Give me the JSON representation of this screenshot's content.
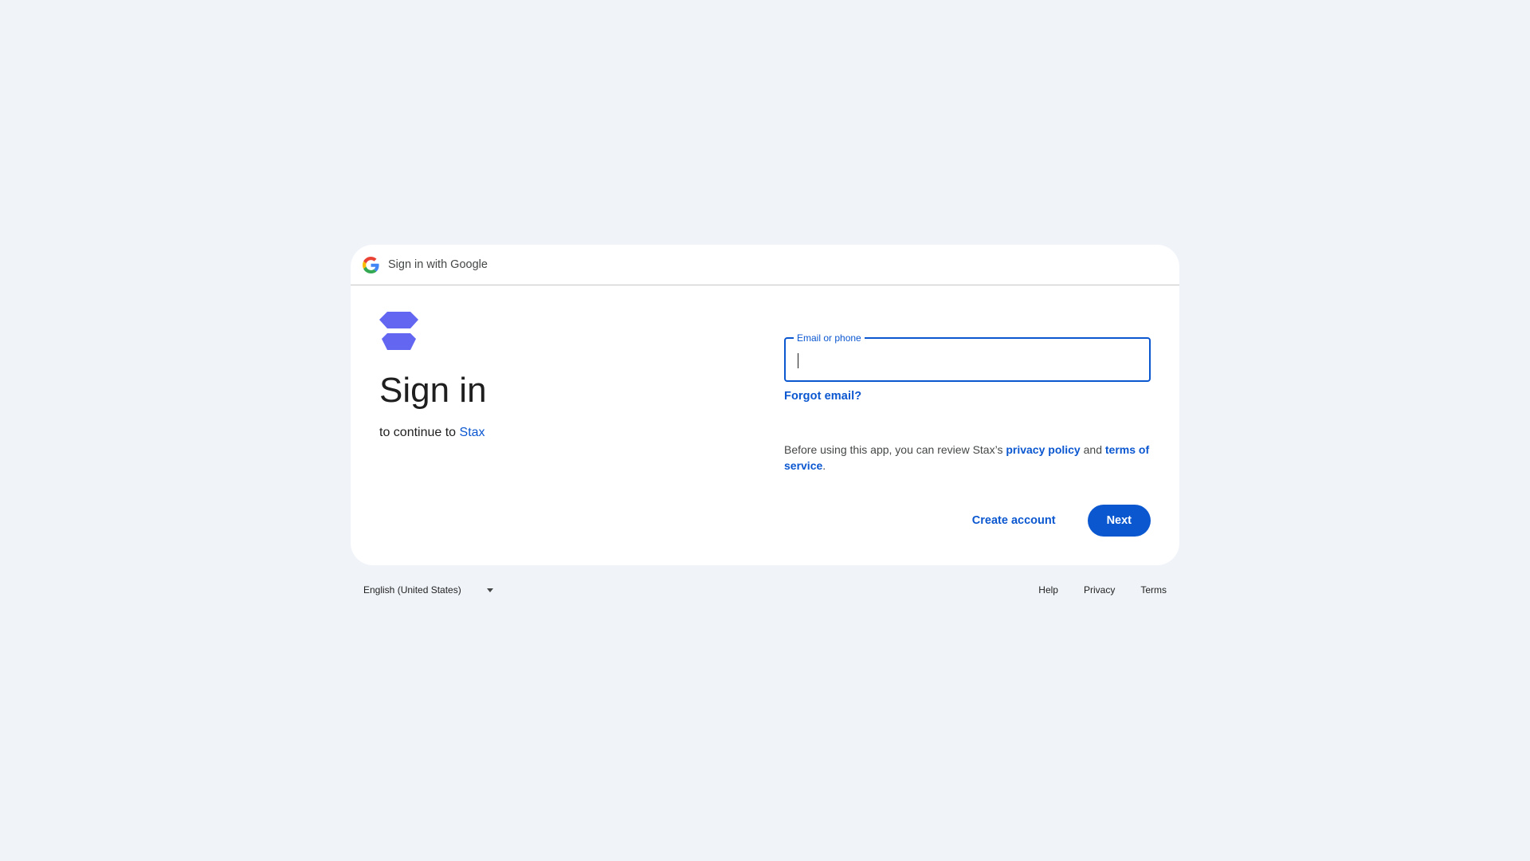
{
  "header": {
    "title": "Sign in with Google"
  },
  "main": {
    "title": "Sign in",
    "subtitle_prefix": "to continue to ",
    "app_name": "Stax",
    "app_color": "#6266f1"
  },
  "form": {
    "email_label": "Email or phone",
    "email_value": "",
    "forgot_email": "Forgot email?",
    "notice_prefix": "Before using this app, you can review Stax’s ",
    "privacy_policy": "privacy policy",
    "notice_and": " and ",
    "terms_of_service": "terms of service",
    "notice_suffix": "."
  },
  "actions": {
    "create_account": "Create account",
    "next": "Next"
  },
  "footer": {
    "language": "English (United States)",
    "help": "Help",
    "privacy": "Privacy",
    "terms": "Terms"
  },
  "colors": {
    "accent": "#0b57d0",
    "background": "#f0f4f9"
  }
}
